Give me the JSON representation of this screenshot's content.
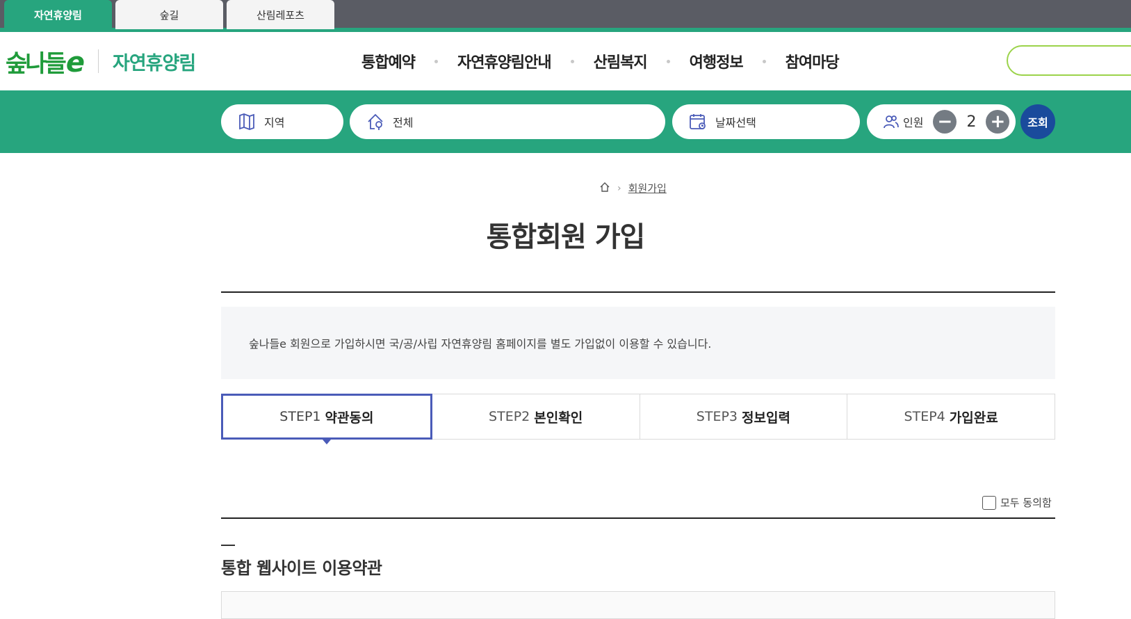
{
  "site_tabs": [
    {
      "label": "자연휴양림",
      "active": true
    },
    {
      "label": "숲길",
      "active": false
    },
    {
      "label": "산림레포츠",
      "active": false
    }
  ],
  "logo": {
    "mark": "숲나들",
    "mark_e": "e",
    "sub": "자연휴양림"
  },
  "gnb": [
    "통합예약",
    "자연휴양림안내",
    "산림복지",
    "여행정보",
    "참여마당"
  ],
  "search": {
    "region_label": "지역",
    "forest_label": "전체",
    "date_label": "날짜선택",
    "people_label": "인원",
    "people_count": "2",
    "minus": "−",
    "plus": "+",
    "submit_label": "조회"
  },
  "breadcrumb": {
    "current": "회원가입"
  },
  "page_title": "통합회원 가입",
  "info_text": "숲나들e 회원으로 가입하시면 국/공/사립 자연휴양림 홈페이지를 별도 가입없이 이용할 수 있습니다.",
  "steps": [
    {
      "num": "STEP1",
      "label": "약관동의",
      "active": true
    },
    {
      "num": "STEP2",
      "label": "본인확인",
      "active": false
    },
    {
      "num": "STEP3",
      "label": "정보입력",
      "active": false
    },
    {
      "num": "STEP4",
      "label": "가입완료",
      "active": false
    }
  ],
  "agree_all_label": "모두 동의함",
  "section_title": "통합 웹사이트 이용약관",
  "colors": {
    "brand_green": "#27a57e",
    "logo_green": "#1f9b3a",
    "step_active": "#4a5bb8",
    "submit_blue": "#1a4b9c"
  }
}
